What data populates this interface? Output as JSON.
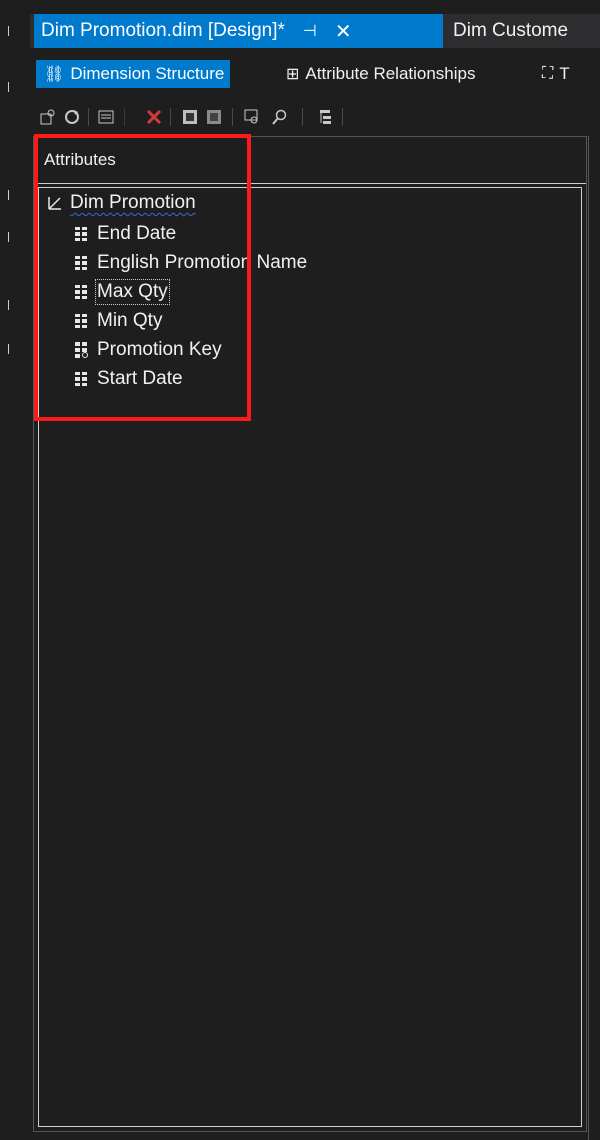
{
  "tabs": {
    "active": {
      "title": "Dim Promotion.dim [Design]*",
      "pin_glyph": "⊣",
      "close_glyph": "✕"
    },
    "inactive": {
      "title": "Dim Custome"
    }
  },
  "designer_tabs": [
    {
      "label": "Dimension Structure",
      "icon": "dimension-structure-icon",
      "glyph": "⛓"
    },
    {
      "label": "Attribute Relationships",
      "icon": "attribute-relationships-icon",
      "glyph": "⊞"
    },
    {
      "label": "T",
      "icon": "translations-icon",
      "glyph": "⛶"
    }
  ],
  "toolbar": {
    "icons": [
      "add-business-intelligence-icon",
      "refresh-icon",
      "show-grid-icon",
      "delete-icon",
      "show-table-icon",
      "hide-table-icon",
      "explore-data-icon",
      "find-icon",
      "hierarchy-icon"
    ]
  },
  "attributes_pane": {
    "header": "Attributes",
    "root": "Dim Promotion",
    "items": [
      {
        "label": "End Date",
        "icon": "attribute-icon"
      },
      {
        "label": "English Promotion Name",
        "icon": "attribute-icon"
      },
      {
        "label": "Max Qty",
        "icon": "attribute-icon"
      },
      {
        "label": "Min Qty",
        "icon": "attribute-icon"
      },
      {
        "label": "Promotion Key",
        "icon": "key-attribute-icon"
      },
      {
        "label": "Start Date",
        "icon": "attribute-icon"
      }
    ]
  },
  "colors": {
    "accent": "#007acc",
    "highlight": "#ff1a1a",
    "background": "#1e1e1e"
  }
}
